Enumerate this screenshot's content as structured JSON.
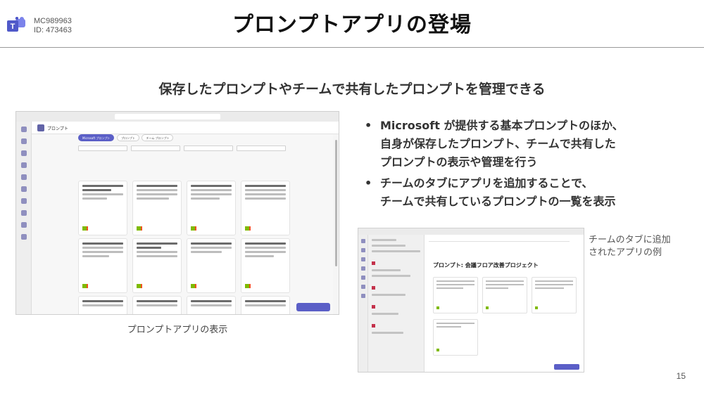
{
  "header": {
    "mc_number": "MC989963",
    "id_text": "ID: 473463",
    "title": "プロンプトアプリの登場"
  },
  "subtitle": "保存したプロンプトやチームで共有したプロンプトを管理できる",
  "bullets": [
    {
      "dot": "•",
      "lines": [
        "Microsoft が提供する基本プロンプトのほか、",
        "自身が保存したプロンプト、チームで共有した",
        "プロンプトの表示や管理を行う"
      ]
    },
    {
      "dot": "•",
      "lines": [
        "チームのタブにアプリを追加することで、",
        "チームで共有しているプロンプトの一覧を表示"
      ]
    }
  ],
  "screenshot1": {
    "app_name": "プロンプト",
    "tabs": [
      "Microsoft プロンプト",
      "プロンプト",
      "チーム プロンプト"
    ],
    "caption": "プロンプトアプリの表示"
  },
  "screenshot2": {
    "heading": "プロンプト: 会議フロア改善プロジェクト",
    "caption_lines": [
      "チームのタブに追加",
      "されたアプリの例"
    ]
  },
  "page_number": "15",
  "colors": {
    "teams_purple": "#5b5fc7",
    "rule_gray": "#9a9a9a"
  }
}
